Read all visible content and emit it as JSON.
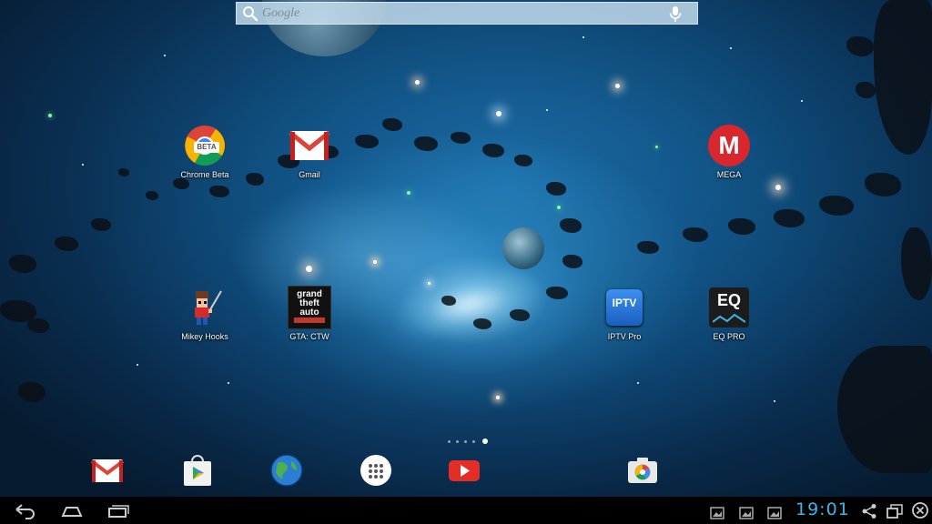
{
  "search": {
    "placeholder": "Google",
    "search_icon": "search-icon",
    "mic_icon": "microphone-icon"
  },
  "apps": [
    {
      "label": "Chrome Beta",
      "icon": "chrome-beta-icon",
      "badge": "BETA"
    },
    {
      "label": "Gmail",
      "icon": "gmail-icon"
    },
    {
      "label": "MEGA",
      "icon": "mega-icon",
      "glyph": "M"
    },
    {
      "label": "Mikey Hooks",
      "icon": "mikey-hooks-icon"
    },
    {
      "label": "GTA: CTW",
      "icon": "gta-ctw-icon",
      "glyph_lines": [
        "grand",
        "theft",
        "auto"
      ]
    },
    {
      "label": "IPTV Pro",
      "icon": "iptv-pro-icon",
      "glyph": "IPTV"
    },
    {
      "label": "EQ PRO",
      "icon": "eq-pro-icon",
      "glyph": "EQ"
    }
  ],
  "page_indicator": {
    "pages": 5,
    "current": 5
  },
  "dock": [
    {
      "icon": "gmail-icon"
    },
    {
      "icon": "play-store-icon"
    },
    {
      "icon": "browser-globe-icon"
    },
    {
      "icon": "app-drawer-icon"
    },
    {
      "icon": "youtube-icon"
    },
    {
      "icon": "camera-icon"
    }
  ],
  "navbar": {
    "back_icon": "back-icon",
    "home_icon": "home-icon",
    "recents_icon": "recent-apps-icon",
    "notifications": [
      "image-notification-icon",
      "image-notification-icon",
      "image-notification-icon"
    ],
    "clock": "19:01",
    "status_icons": [
      "share-icon",
      "window-icon",
      "close-circle-icon"
    ]
  },
  "colors": {
    "clock": "#39b6e6",
    "mega": "#d9272e",
    "youtube": "#e52d27",
    "iptv": "#1a73d1"
  }
}
